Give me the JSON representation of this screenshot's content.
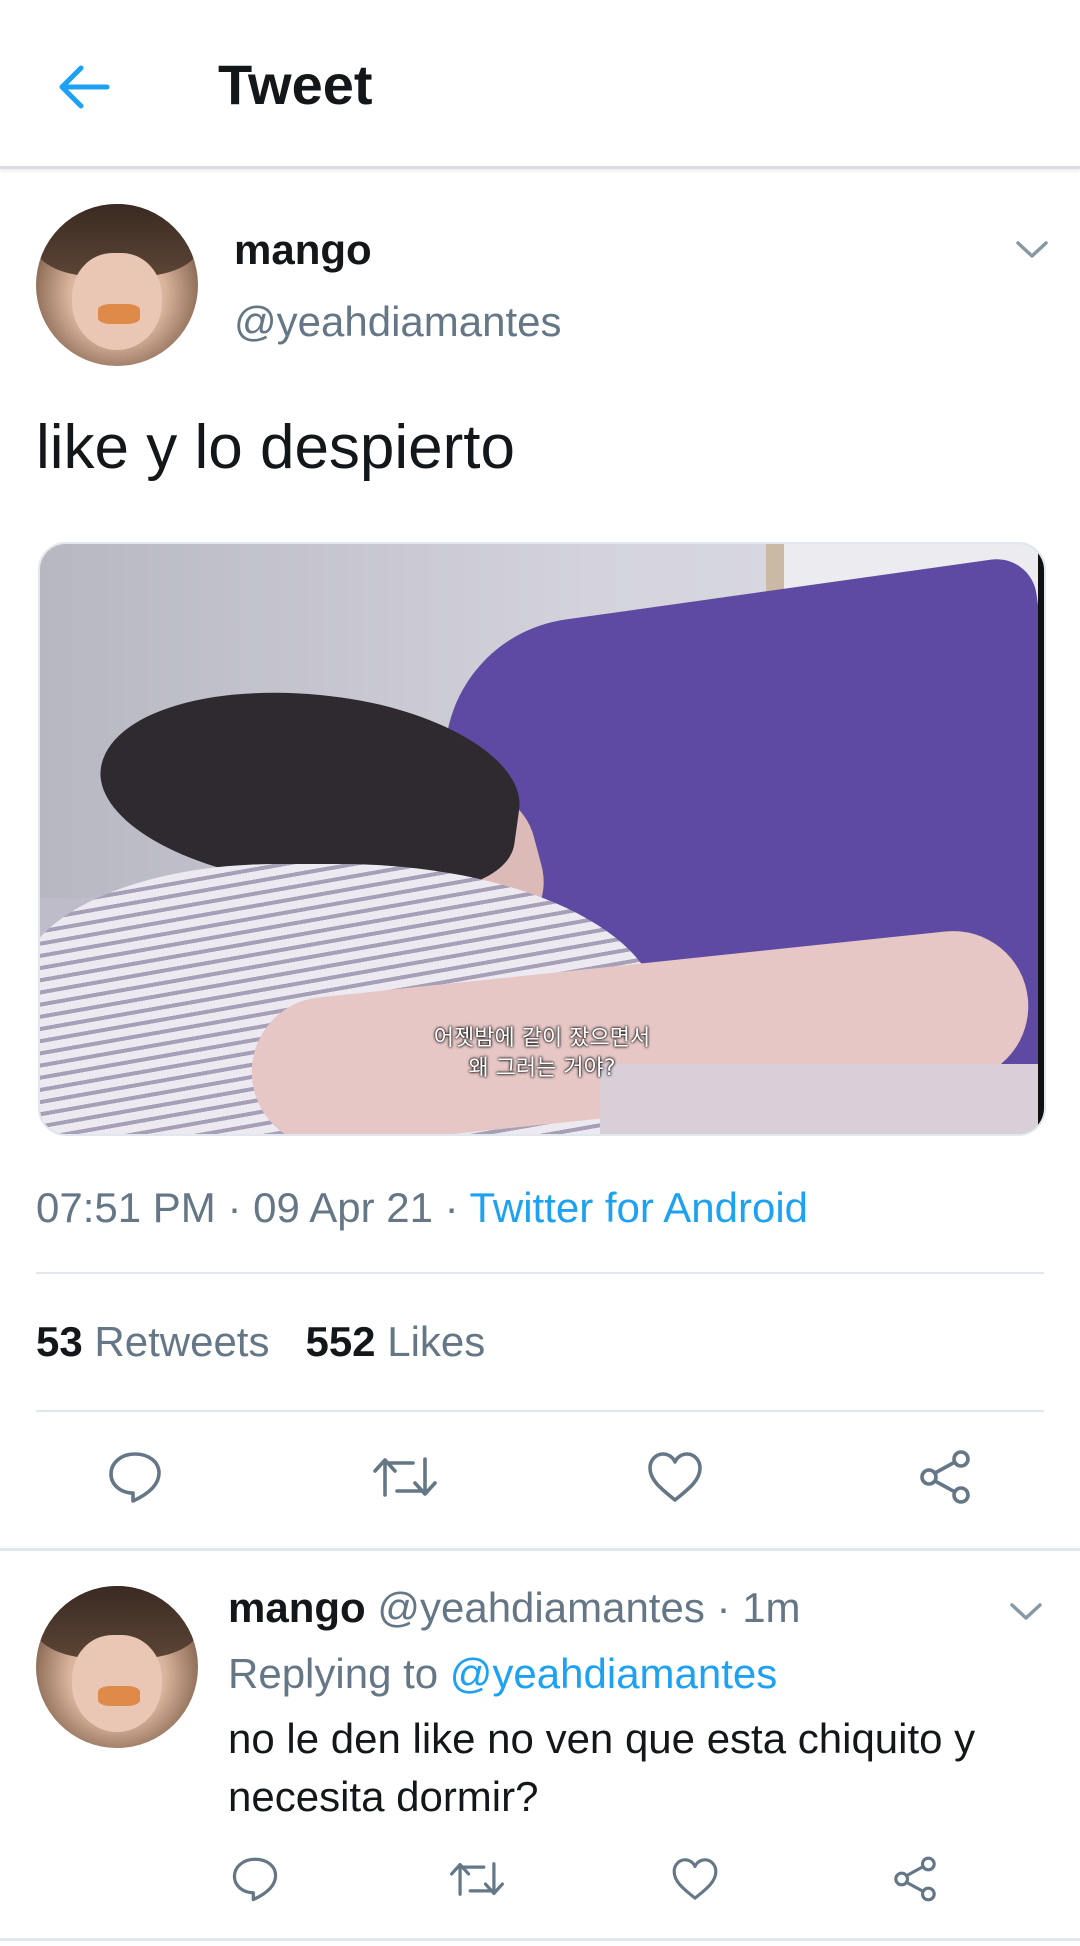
{
  "header": {
    "title": "Tweet",
    "back_icon": "arrow-left-icon",
    "accent_color": "#1da1f2"
  },
  "tweet": {
    "display_name": "mango",
    "handle": "@yeahdiamantes",
    "text": "like y lo despierto",
    "media": {
      "subtitle_line1": "어젯밤에 같이 잤으면서",
      "subtitle_line2": "왜 그러는 거야?"
    },
    "time": "07:51 PM",
    "date": "09 Apr 21",
    "source": "Twitter for Android",
    "separator": "·",
    "retweets_count": "53",
    "retweets_label": "Retweets",
    "likes_count": "552",
    "likes_label": "Likes"
  },
  "reply": {
    "display_name": "mango",
    "handle": "@yeahdiamantes",
    "time_ago": "1m",
    "replying_prefix": "Replying to",
    "replying_to": "@yeahdiamantes",
    "text": "no le den like no ven que esta chiquito y necesita dormir?"
  },
  "icons": {
    "reply": "reply-icon",
    "retweet": "retweet-icon",
    "like": "heart-icon",
    "share": "share-icon",
    "caret": "chevron-down-icon"
  },
  "colors": {
    "text_primary": "#14171a",
    "text_secondary": "#657786",
    "link": "#1da1f2",
    "divider": "#e1e8ed"
  }
}
